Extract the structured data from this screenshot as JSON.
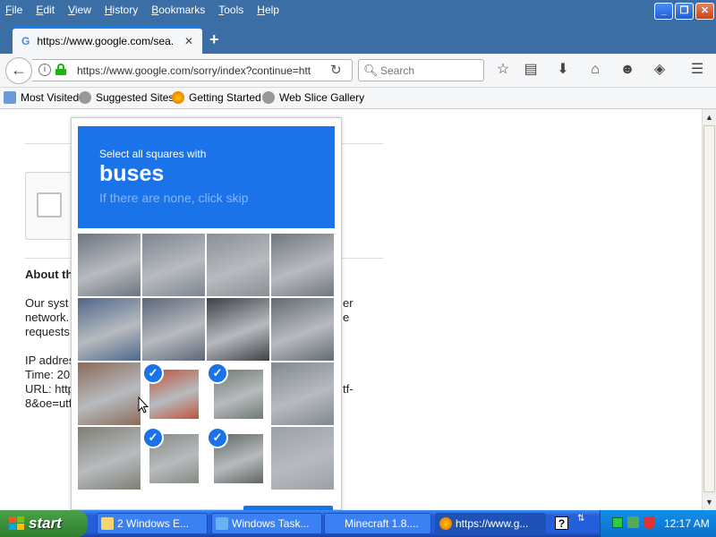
{
  "menubar": {
    "items": [
      "File",
      "Edit",
      "View",
      "History",
      "Bookmarks",
      "Tools",
      "Help"
    ]
  },
  "tab": {
    "title": "https://www.google.com/sea...",
    "favicon": "G"
  },
  "navbar": {
    "url": "https://www.google.com/sorry/index?continue=htt",
    "search_placeholder": "Search"
  },
  "bookmarks": [
    "Most Visited",
    "Suggested Sites",
    "Getting Started",
    "Web Slice Gallery"
  ],
  "page": {
    "about_heading": "About th",
    "line1": "Our syst",
    "line2": "network.",
    "line3": "requests",
    "ip": "IP addres",
    "time": "Time: 20",
    "url": "URL: http",
    "url2": "8&oe=utf",
    "right1": "er",
    "right2": "e",
    "right3": "tf-"
  },
  "challenge": {
    "instruction": "Select all squares with",
    "keyword": "buses",
    "subtext": "If there are none, click skip",
    "tiles": [
      {
        "row": 0,
        "col": 0,
        "selected": false
      },
      {
        "row": 0,
        "col": 1,
        "selected": false
      },
      {
        "row": 0,
        "col": 2,
        "selected": false
      },
      {
        "row": 0,
        "col": 3,
        "selected": false
      },
      {
        "row": 1,
        "col": 0,
        "selected": false
      },
      {
        "row": 1,
        "col": 1,
        "selected": false
      },
      {
        "row": 1,
        "col": 2,
        "selected": false
      },
      {
        "row": 1,
        "col": 3,
        "selected": false
      },
      {
        "row": 2,
        "col": 0,
        "selected": false
      },
      {
        "row": 2,
        "col": 1,
        "selected": true
      },
      {
        "row": 2,
        "col": 2,
        "selected": true
      },
      {
        "row": 2,
        "col": 3,
        "selected": false
      },
      {
        "row": 3,
        "col": 0,
        "selected": false
      },
      {
        "row": 3,
        "col": 1,
        "selected": true
      },
      {
        "row": 3,
        "col": 2,
        "selected": true
      },
      {
        "row": 3,
        "col": 3,
        "selected": false
      }
    ]
  },
  "taskbar": {
    "start_label": "start",
    "tasks": [
      "2 Windows E...",
      "Windows Task...",
      "Minecraft 1.8....",
      "https://www.g..."
    ],
    "clock": "12:17 AM"
  },
  "colors": {
    "accent": "#1a73e8",
    "xp_blue": "#245edb",
    "start_green": "#3c8f3c"
  }
}
